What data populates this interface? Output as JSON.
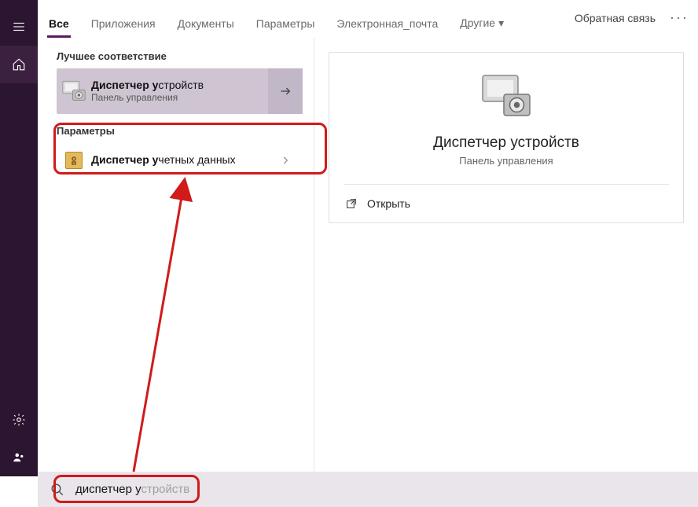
{
  "rail": {
    "menu": "menu-icon",
    "home": "home-icon",
    "settings": "gear-icon",
    "switch_user": "user-switch-icon"
  },
  "tabs": {
    "all": "Все",
    "apps": "Приложения",
    "documents": "Документы",
    "settings": "Параметры",
    "email": "Электронная_почта",
    "more": "Другие"
  },
  "topright": {
    "feedback": "Обратная связь"
  },
  "left": {
    "best_match_label": "Лучшее соответствие",
    "best": {
      "title_prefix": "Диспетчер у",
      "title_rest": "стройств",
      "subtitle": "Панель управления"
    },
    "settings_label": "Параметры",
    "cred": {
      "title_prefix": "Диспетчер у",
      "title_rest": "четных данных"
    }
  },
  "preview": {
    "title": "Диспетчер устройств",
    "subtitle": "Панель управления",
    "open": "Открыть"
  },
  "search": {
    "typed": "диспетчер у",
    "ghost": "стройств"
  }
}
